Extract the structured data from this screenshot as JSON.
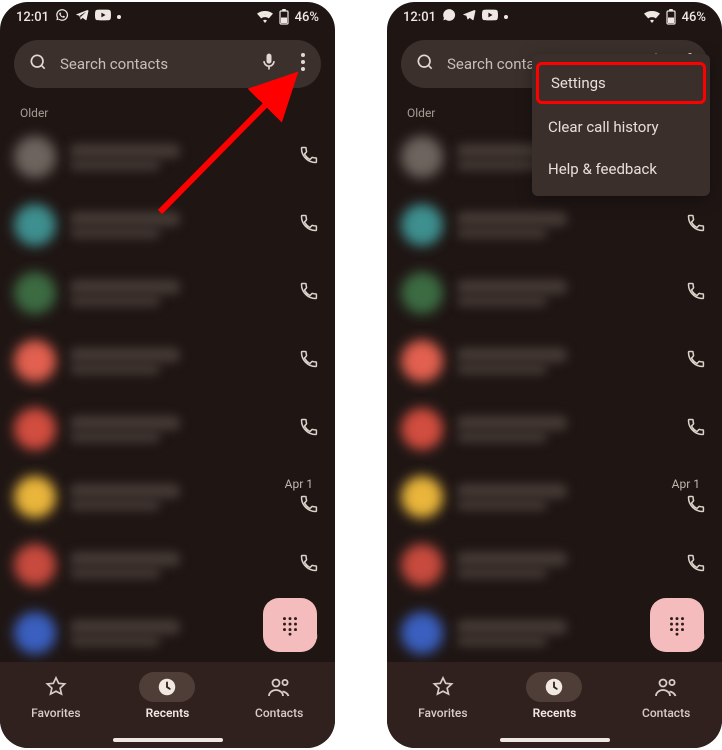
{
  "status": {
    "time": "12:01",
    "battery": "46%"
  },
  "search": {
    "placeholder": "Search contacts"
  },
  "section": {
    "older": "Older"
  },
  "calls": [
    {
      "avatarColor": "#6d645e",
      "date": ""
    },
    {
      "avatarColor": "#3e8f8f",
      "date": ""
    },
    {
      "avatarColor": "#3c6b42",
      "date": ""
    },
    {
      "avatarColor": "#e2604f",
      "date": ""
    },
    {
      "avatarColor": "#d14d3f",
      "date": ""
    },
    {
      "avatarColor": "#e9b53b",
      "date": "Apr 1"
    },
    {
      "avatarColor": "#c74a3e",
      "date": ""
    },
    {
      "avatarColor": "#3a5fbf",
      "date": ""
    }
  ],
  "nav": {
    "favorites": "Favorites",
    "recents": "Recents",
    "contacts": "Contacts"
  },
  "menu": {
    "settings": "Settings",
    "clear": "Clear call history",
    "help": "Help & feedback"
  }
}
